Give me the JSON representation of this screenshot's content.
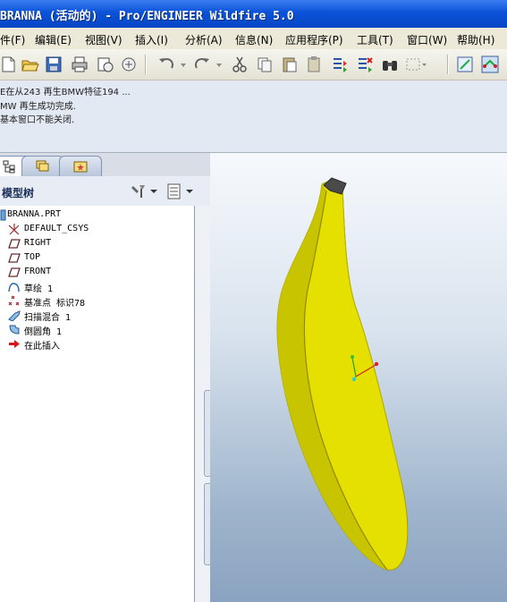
{
  "window": {
    "title": "BRANNA (活动的) - Pro/ENGINEER Wildfire 5.0"
  },
  "menu": [
    {
      "label": "件(F)"
    },
    {
      "label": "编辑(E)"
    },
    {
      "label": "视图(V)"
    },
    {
      "label": "插入(I)"
    },
    {
      "label": "分析(A)"
    },
    {
      "label": "信息(N)"
    },
    {
      "label": "应用程序(P)"
    },
    {
      "label": "工具(T)"
    },
    {
      "label": "窗口(W)"
    },
    {
      "label": "帮助(H)"
    }
  ],
  "toolbar": {
    "icons": [
      "new-icon",
      "open-icon",
      "save-icon",
      "print-icon",
      "send-icon",
      "mail-icon",
      "undo-icon",
      "redo-icon",
      "cut-icon",
      "copy-icon",
      "paste-icon",
      "paste-special-icon",
      "regenerate-icon",
      "regen-manager-icon",
      "find-icon",
      "select-box-icon",
      "model-tree-toggle-icon",
      "datum-toggle-icon"
    ]
  },
  "messages": [
    "E在从243 再生BMW特征194 ...",
    "MW 再生成功完成.",
    "基本窗口不能关闭."
  ],
  "navigator": {
    "tabs": [
      "model-tree-tab-icon",
      "layer-tab-icon",
      "favorites-tab-icon"
    ],
    "title": "模型树",
    "settings_icon": "tree-settings-icon",
    "columns_icon": "tree-columns-icon"
  },
  "model_tree": [
    {
      "label": "BRANNA.PRT",
      "icon": "part-icon"
    },
    {
      "label": "DEFAULT_CSYS",
      "icon": "csys-icon"
    },
    {
      "label": "RIGHT",
      "icon": "datum-plane-icon"
    },
    {
      "label": "TOP",
      "icon": "datum-plane-icon"
    },
    {
      "label": "FRONT",
      "icon": "datum-plane-icon"
    },
    {
      "label": "草绘 1",
      "icon": "sketch-icon"
    },
    {
      "label": "基准点 标识78",
      "icon": "datum-point-icon"
    },
    {
      "label": "扫描混合 1",
      "icon": "swept-blend-icon"
    },
    {
      "label": "倒圆角 1",
      "icon": "round-icon"
    },
    {
      "label": "在此插入",
      "icon": "insert-here-arrow-icon"
    }
  ],
  "colors": {
    "title_bar": "#0a52d8",
    "model_yellow": "#e6e000",
    "viewport_bottom": "#8aa3c0"
  }
}
